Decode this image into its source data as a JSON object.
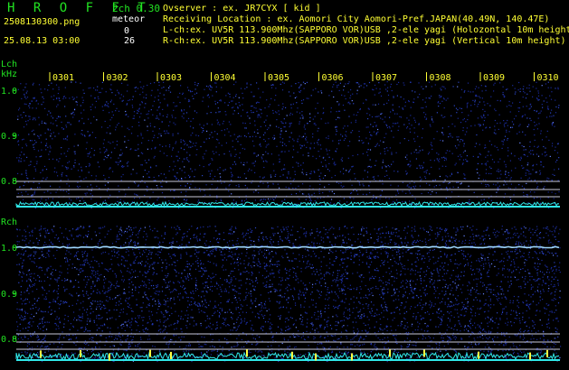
{
  "header": {
    "title": "H R O F F T",
    "version": "2ch 0.30",
    "filename": "2508130300.png",
    "meteor_label": "meteor",
    "l_count": "0",
    "datetime": "25.08.13 03:00",
    "r_count": "26",
    "observer": "Ovserver                  : ex. JR7CYX [ kid ]",
    "location": "Receiving Location : ex. Aomori City Aomori-Pref.JAPAN(40.49N, 140.47E)",
    "lch_info": "L-ch:ex. UV5R 113.900Mhz(SAPPORO VOR)USB ,2-ele yagi (Holozontal 10m height",
    "rch_info": "R-ch:ex. UV5R 113.900Mhz(SAPPORO VOR)USB ,2-ele yagi (Vertical 10m height)"
  },
  "lch_panel": {
    "label": "Lch",
    "unit": "kHz",
    "y_ticks": [
      "1.0",
      "0.9",
      "0.8"
    ],
    "x_ticks": [
      "0301",
      "0302",
      "0303",
      "0304",
      "0305",
      "0306",
      "0307",
      "0308",
      "0309",
      "0310"
    ]
  },
  "rch_panel": {
    "label": "Rch",
    "y_ticks": [
      "1.0",
      "0.9",
      "0.8"
    ]
  },
  "colors": {
    "background": "#000000",
    "noise": "#1a2a9a",
    "signal": "#9fd8ff",
    "baseline": "#30e8e8",
    "meteor": "#ffff40",
    "text_green": "#22e322",
    "text_yellow": "#ffff33"
  }
}
